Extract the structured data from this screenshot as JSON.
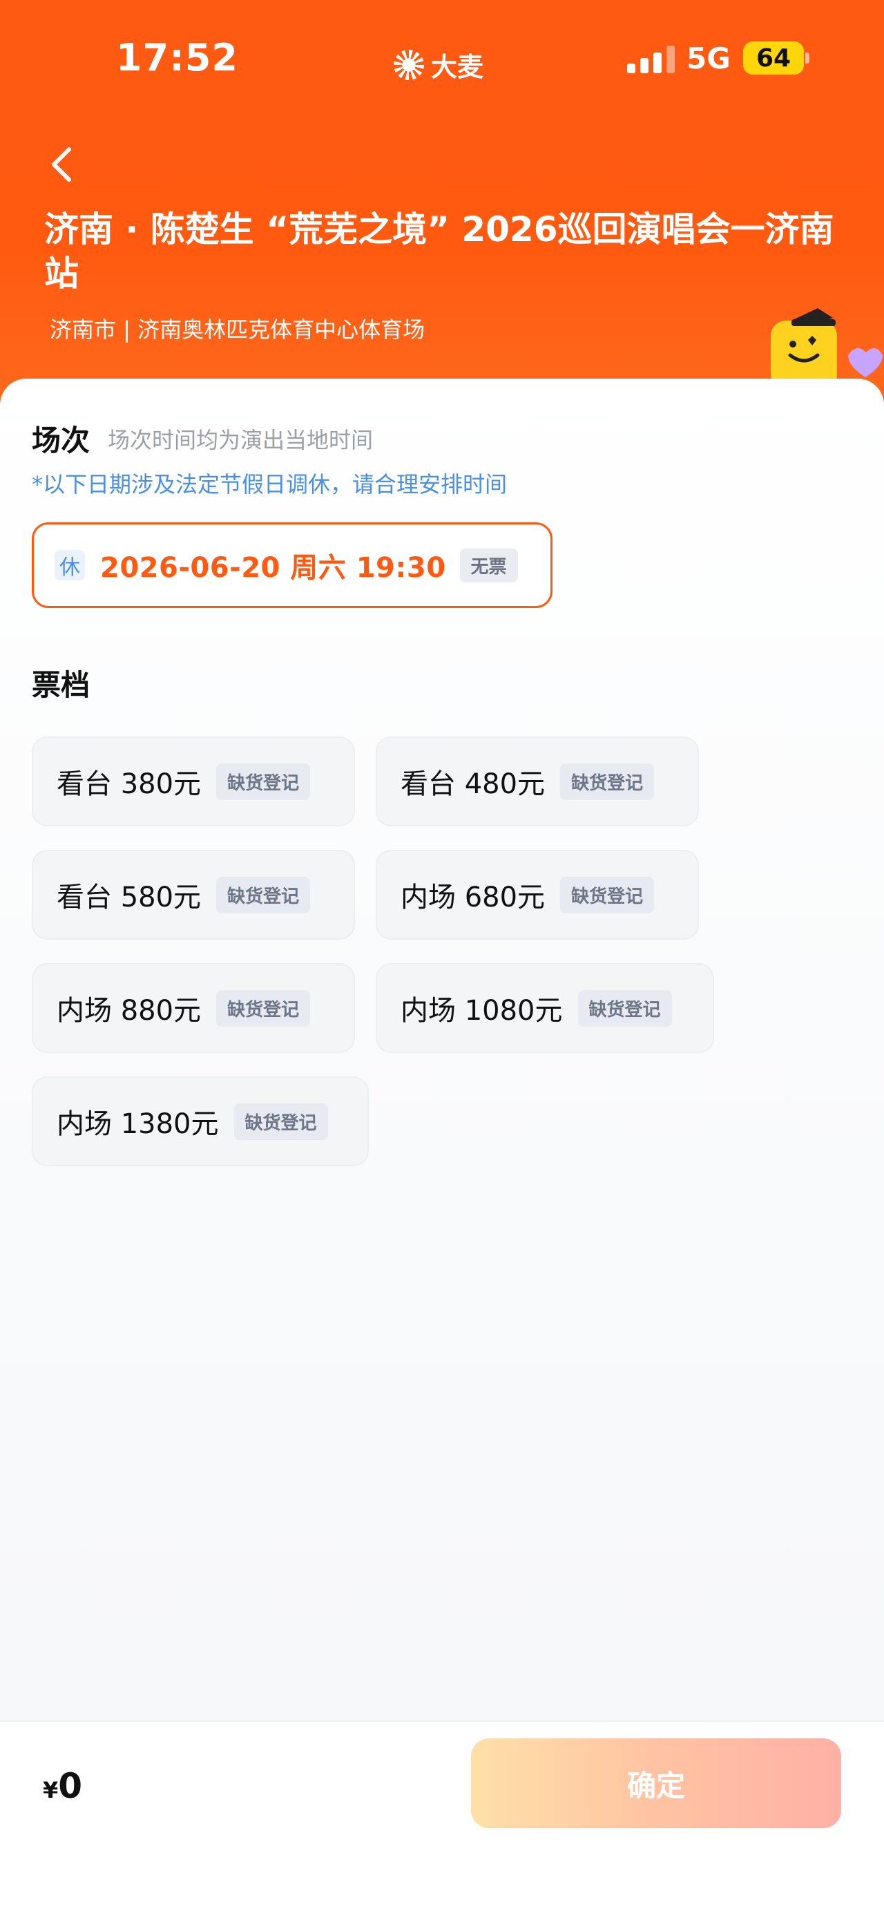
{
  "status_bar": {
    "time": "17:52",
    "brand": "大麦",
    "network": "5G",
    "battery": "64"
  },
  "header": {
    "back_icon": "chevron-left-icon",
    "title": "济南 · 陈楚生 “荒芜之境” 2026巡回演唱会一济南站",
    "venue": "济南市 | 济南奥林匹克体育中心体育场"
  },
  "session_section": {
    "title": "场次",
    "subtitle": "场次时间均为演出当地时间",
    "notice": "*以下日期涉及法定节假日调休，请合理安排时间",
    "session": {
      "rest_tag": "休",
      "datetime": "2026-06-20  周六 19:30",
      "status": "无票"
    }
  },
  "tier_section": {
    "title": "票档",
    "tiers": [
      {
        "label": "看台 380元",
        "badge": "缺货登记"
      },
      {
        "label": "看台 480元",
        "badge": "缺货登记"
      },
      {
        "label": "看台 580元",
        "badge": "缺货登记"
      },
      {
        "label": "内场 680元",
        "badge": "缺货登记"
      },
      {
        "label": "内场 880元",
        "badge": "缺货登记"
      },
      {
        "label": "内场 1080元",
        "badge": "缺货登记"
      },
      {
        "label": "内场 1380元",
        "badge": "缺货登记"
      }
    ]
  },
  "footer": {
    "currency": "¥",
    "amount": "0",
    "confirm_label": "确定"
  },
  "colors": {
    "brand_orange": "#ff5a12",
    "notice_blue": "#4a8fe0"
  }
}
